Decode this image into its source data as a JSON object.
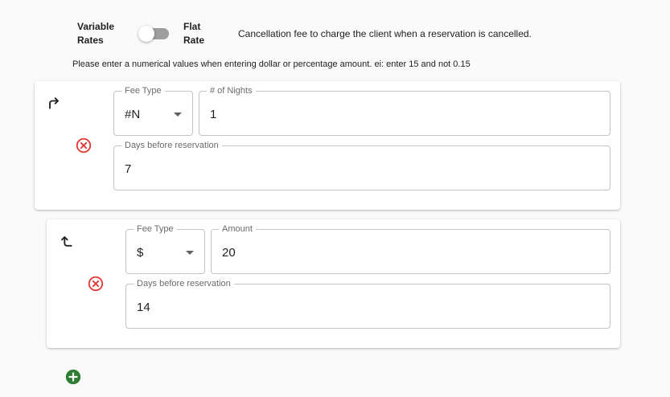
{
  "rate_toggle": {
    "left_label_line1": "Variable",
    "left_label_line2": "Rates",
    "right_label_line1": "Flat",
    "right_label_line2": "Rate",
    "state": "off"
  },
  "description": "Cancellation fee to charge the client when a reservation is cancelled.",
  "hint": "Please enter a numerical values when entering dollar or percentage amount. ei: enter 15 and not 0.15",
  "fees": [
    {
      "arrow_icon": "arrow-turn-up-right-icon",
      "fee_type": {
        "label": "Fee Type",
        "value": "#N"
      },
      "amount": {
        "label": "# of Nights",
        "value": "1"
      },
      "days_before": {
        "label": "Days before reservation",
        "value": "7"
      },
      "remove_icon": "remove-circle-icon"
    },
    {
      "arrow_icon": "arrow-turn-up-left-icon",
      "fee_type": {
        "label": "Fee Type",
        "value": "$"
      },
      "amount": {
        "label": "Amount",
        "value": "20"
      },
      "days_before": {
        "label": "Days before reservation",
        "value": "14"
      },
      "remove_icon": "remove-circle-icon"
    }
  ],
  "add_button_icon": "add-circle-icon",
  "colors": {
    "remove": "#e53935",
    "add": "#2e7d32",
    "switch_track": "#9e9e9e",
    "border": "#c4c4c4"
  }
}
